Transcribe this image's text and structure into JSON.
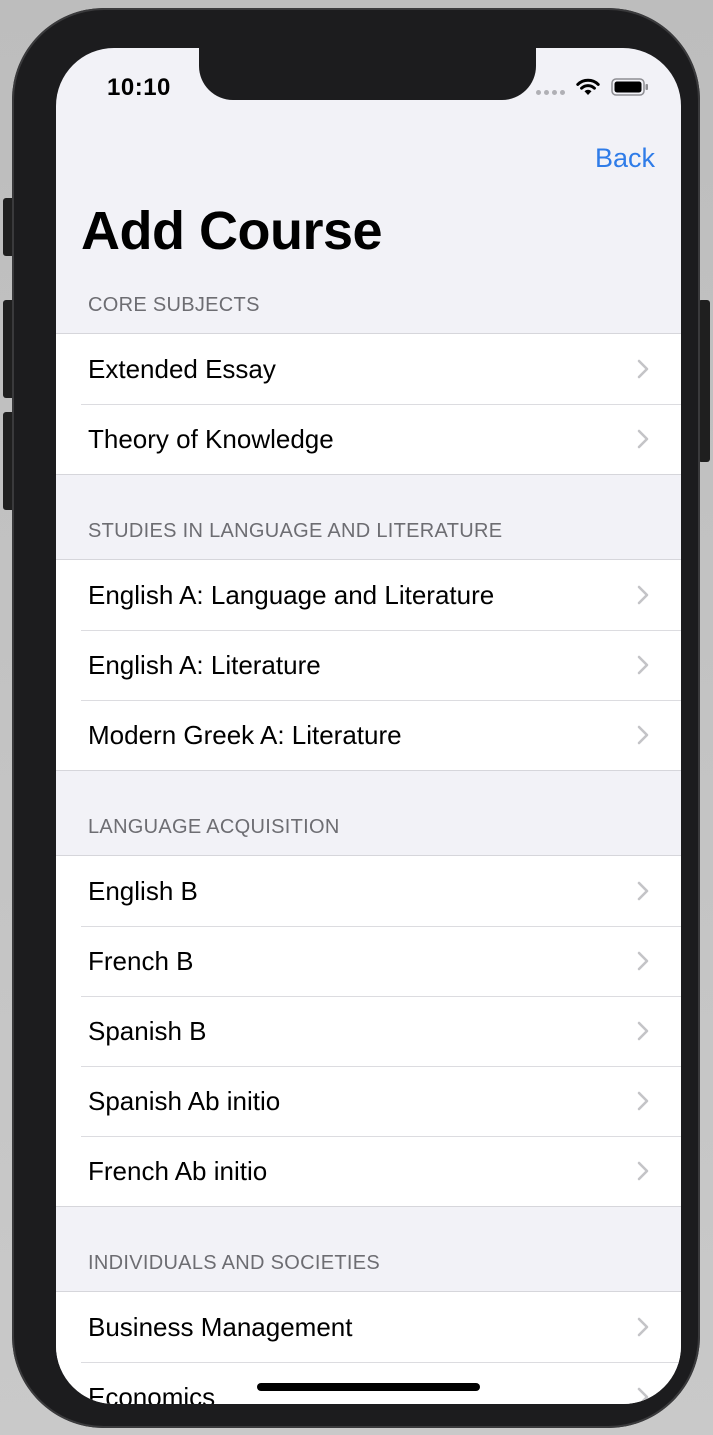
{
  "status_bar": {
    "time": "10:10"
  },
  "nav": {
    "back_label": "Back",
    "title": "Add Course"
  },
  "colors": {
    "accent": "#2f7ce8",
    "background": "#f2f2f7",
    "section_header": "#6d6d72",
    "chevron": "#c4c4c7"
  },
  "icons": {
    "row_accessory": "chevron-right-icon",
    "wifi": "wifi-icon",
    "battery": "battery-icon",
    "signal": "signal-dots-icon"
  },
  "sections": [
    {
      "header": "CORE SUBJECTS",
      "items": [
        "Extended Essay",
        "Theory of Knowledge"
      ]
    },
    {
      "header": "STUDIES IN LANGUAGE AND LITERATURE",
      "items": [
        "English A: Language and Literature",
        "English A: Literature",
        "Modern Greek A: Literature"
      ]
    },
    {
      "header": "LANGUAGE ACQUISITION",
      "items": [
        "English B",
        "French B",
        "Spanish B",
        "Spanish Ab initio",
        "French Ab initio"
      ]
    },
    {
      "header": "INDIVIDUALS AND SOCIETIES",
      "items": [
        "Business Management",
        "Economics"
      ]
    }
  ]
}
